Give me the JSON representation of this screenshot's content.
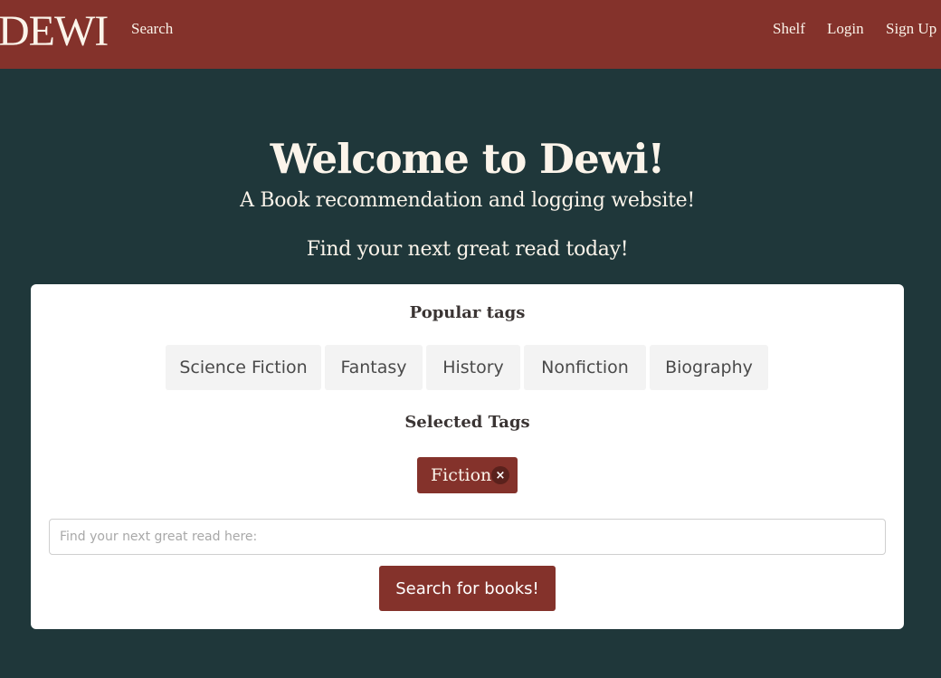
{
  "navbar": {
    "brand": "DEWI",
    "search_label": "Search",
    "shelf_label": "Shelf",
    "login_label": "Login",
    "signup_label": "Sign Up"
  },
  "hero": {
    "title": "Welcome to Dewi!",
    "subtitle": "A Book recommendation and logging website!",
    "tagline": "Find your next great read today!"
  },
  "card": {
    "popular_heading": "Popular tags",
    "popular_tags": [
      "Science Fiction",
      "Fantasy",
      "History",
      "Nonfiction",
      "Biography"
    ],
    "selected_heading": "Selected Tags",
    "selected_tags": [
      "Fiction"
    ],
    "remove_glyph": "×",
    "search_placeholder": "Find your next great read here:",
    "search_value": "",
    "search_button_label": "Search for books!"
  },
  "colors": {
    "brand_red": "#84322b",
    "background": "#1f373a",
    "card": "#ffffff",
    "chip": "#f3f3f3"
  }
}
